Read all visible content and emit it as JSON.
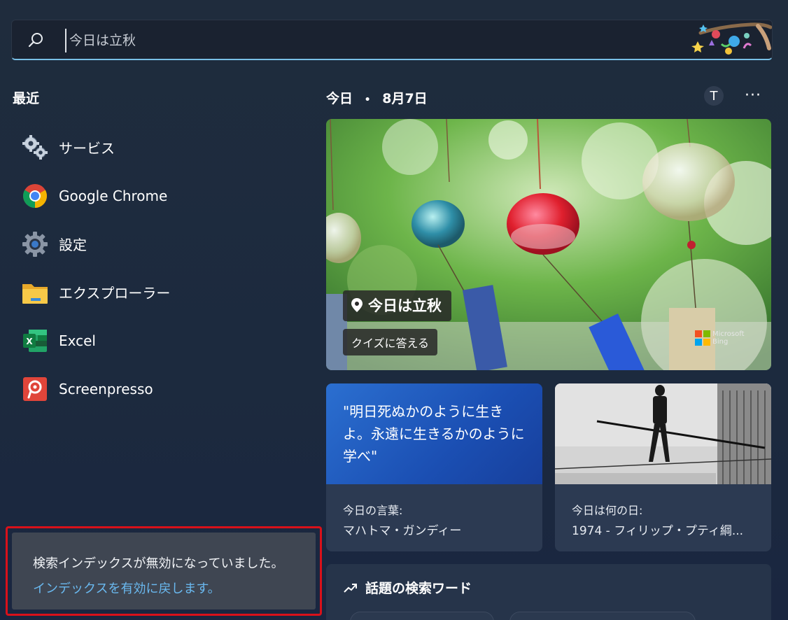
{
  "search": {
    "placeholder": "今日は立秋"
  },
  "recent": {
    "title": "最近",
    "items": [
      {
        "label": "サービス",
        "icon": "gears-icon"
      },
      {
        "label": "Google Chrome",
        "icon": "chrome-icon"
      },
      {
        "label": "設定",
        "icon": "settings-gear-icon"
      },
      {
        "label": "エクスプローラー",
        "icon": "folder-icon"
      },
      {
        "label": "Excel",
        "icon": "excel-icon"
      },
      {
        "label": "Screenpresso",
        "icon": "screenpresso-icon"
      }
    ]
  },
  "notice": {
    "text": "検索インデックスが無効になっていました。",
    "link": "インデックスを有効に戻します。"
  },
  "today": {
    "label": "今日",
    "separator": "•",
    "date": "8月7日",
    "avatar": "T",
    "more": "···"
  },
  "hero": {
    "title": "今日は立秋",
    "quiz": "クイズに答える",
    "bing_line1": "Microsoft",
    "bing_line2": "Bing"
  },
  "cards": {
    "quote": {
      "text": "\"明日死ぬかのように生きよ。永遠に生きるかのように学べ\"",
      "label": "今日の言葉:",
      "author": "マハトマ・ガンディー"
    },
    "history": {
      "label": "今日は何の日:",
      "text": "1974 - フィリップ・プティ綱..."
    }
  },
  "trending": {
    "title": "話題の検索ワード"
  },
  "colors": {
    "accent": "#79bfe6",
    "link": "#6ab9f0",
    "highlight_border": "#d9111a"
  }
}
